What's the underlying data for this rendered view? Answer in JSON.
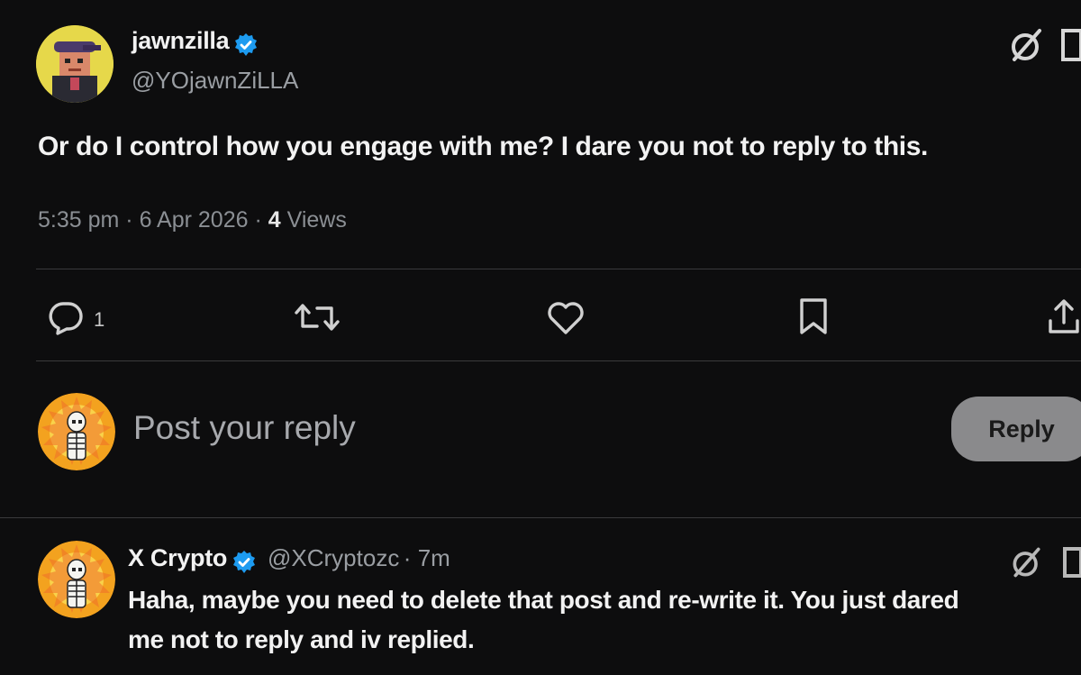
{
  "tweet": {
    "author_name": "jawnzilla",
    "author_handle": "@YOjawnZiLLA",
    "text": "Or do I control how you engage with me? I dare you not to reply to this.",
    "time": "5:35 pm",
    "date": "6 Apr 2026",
    "views_count": "4",
    "views_label": "Views",
    "reply_count": "1"
  },
  "composer": {
    "placeholder": "Post your reply",
    "button_label": "Reply"
  },
  "reply": {
    "author_name": "X Crypto",
    "author_handle": "@XCryptozc",
    "age": "7m",
    "text_line1": "Haha, maybe you need to delete that post and re-write it. You just dared",
    "text_line2": "me not to reply and iv replied."
  },
  "colors": {
    "background": "#0d0d0e",
    "verified_blue": "#1d9bf0",
    "divider": "#3a3a3c",
    "muted_text": "#8b8f94"
  },
  "icons": [
    "grok-icon",
    "more-icon",
    "reply-icon",
    "repost-icon",
    "like-icon",
    "bookmark-icon",
    "share-icon",
    "verified-badge-icon"
  ]
}
